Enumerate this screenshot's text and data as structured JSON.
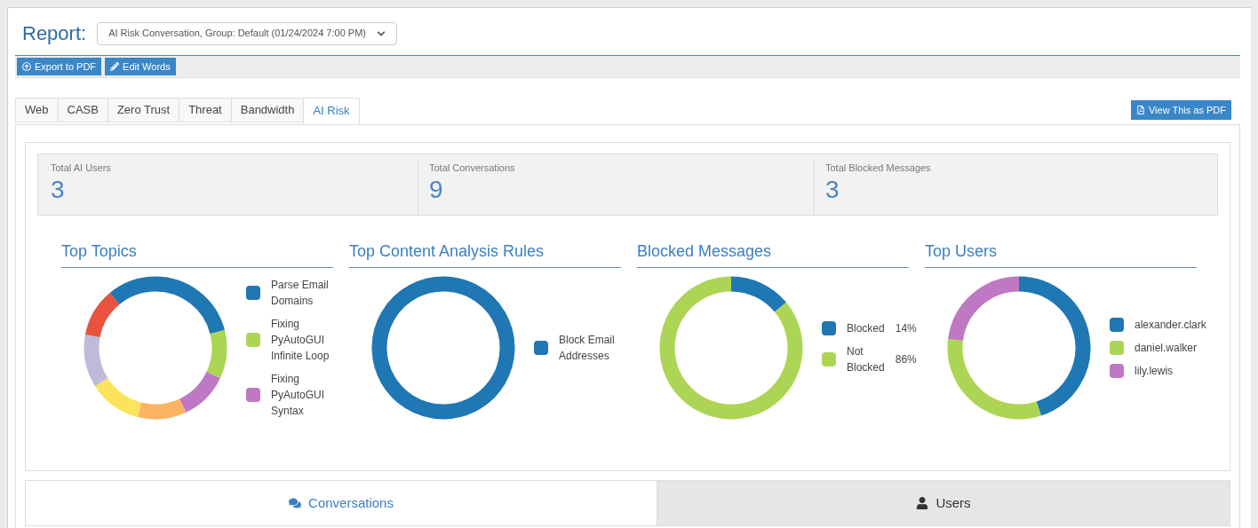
{
  "report": {
    "label": "Report:",
    "selection": "AI Risk Conversation, Group: Default (01/24/2024 7:00 PM)"
  },
  "toolbar": [
    {
      "label": "Export to PDF",
      "kind": "export"
    },
    {
      "label": "Edit Words",
      "kind": "edit"
    }
  ],
  "tabs": [
    {
      "label": "Web",
      "selected": false
    },
    {
      "label": "CASB",
      "selected": false
    },
    {
      "label": "Zero Trust",
      "selected": false
    },
    {
      "label": "Threat",
      "selected": false
    },
    {
      "label": "Bandwidth",
      "selected": false
    },
    {
      "label": "AI Risk",
      "selected": true
    }
  ],
  "view_pdf_button": "View This as PDF",
  "stats": [
    {
      "label": "Total AI Users",
      "value": "3"
    },
    {
      "label": "Total Conversations",
      "value": "9"
    },
    {
      "label": "Total Blocked Messages",
      "value": "3"
    }
  ],
  "charts": [
    {
      "title": "Top Topics",
      "legend": [
        {
          "label": "Parse Email Domains",
          "color": "#1f77b4"
        },
        {
          "label": "Fixing PyAutoGUI Infinite Loop",
          "color": "#add555"
        },
        {
          "label": "Fixing PyAutoGUI Syntax",
          "color": "#bf78c3"
        }
      ]
    },
    {
      "title": "Top Content Analysis Rules",
      "legend": [
        {
          "label": "Block Email Addresses",
          "color": "#1f77b4"
        }
      ]
    },
    {
      "title": "Blocked Messages",
      "legend": [
        {
          "label": "Blocked",
          "share": "14%",
          "color": "#1f77b4"
        },
        {
          "label": "Not Blocked",
          "share": "86%",
          "color": "#add555"
        }
      ]
    },
    {
      "title": "Top Users",
      "legend": [
        {
          "label": "alexander.clark",
          "color": "#1f77b4"
        },
        {
          "label": "daniel.walker",
          "color": "#add555"
        },
        {
          "label": "lily.lewis",
          "color": "#bf78c3"
        }
      ]
    }
  ],
  "bottom_tabs": [
    {
      "label": "Conversations",
      "kind": "conversations",
      "selected": true
    },
    {
      "label": "Users",
      "kind": "users",
      "selected": false
    }
  ]
}
